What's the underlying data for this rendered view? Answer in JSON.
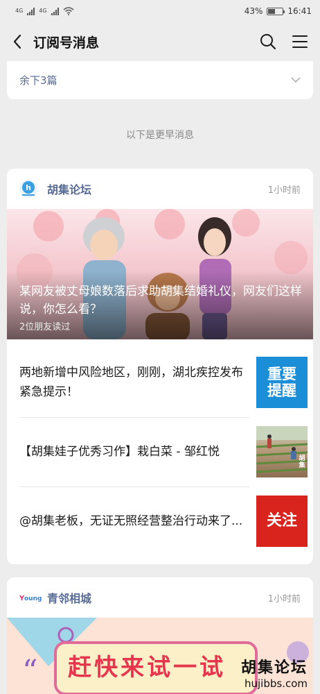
{
  "status_bar": {
    "network_1": "4G",
    "network_2": "4G",
    "battery": "43%",
    "time": "16:41"
  },
  "header": {
    "title": "订阅号消息",
    "icons": [
      "back-icon",
      "search-icon",
      "menu-icon"
    ]
  },
  "remaining": {
    "label": "余下3篇"
  },
  "divider_text": "以下是更早消息",
  "card1": {
    "account_name": "胡集论坛",
    "time": "1小时前",
    "hero": {
      "title": "某网友被丈母娘数落后求助胡集结婚礼仪，网友们这样说，你怎么看？",
      "sub": "2位朋友读过"
    },
    "items": [
      {
        "text": "两地新增中风险地区，刚刚，湖北疾控发布紧急提示！",
        "thumb_text": "重要提醒"
      },
      {
        "text": "【胡集娃子优秀习作】栽白菜 - 邹红悦",
        "thumb_text": "胡集"
      },
      {
        "text": "@胡集老板，无证无照经营整治行动来了...",
        "thumb_text": "关注"
      }
    ]
  },
  "card2": {
    "account_name": "青邻相城",
    "time": "1小时前",
    "poster_text": "赶快来试一试"
  },
  "watermark": {
    "big": "胡集论坛",
    "small": "hujibbs.com"
  },
  "colors": {
    "link": "#576b95",
    "thumb_blue": "#1a8fd8",
    "thumb_red": "#d9231d",
    "background": "#ededed"
  }
}
